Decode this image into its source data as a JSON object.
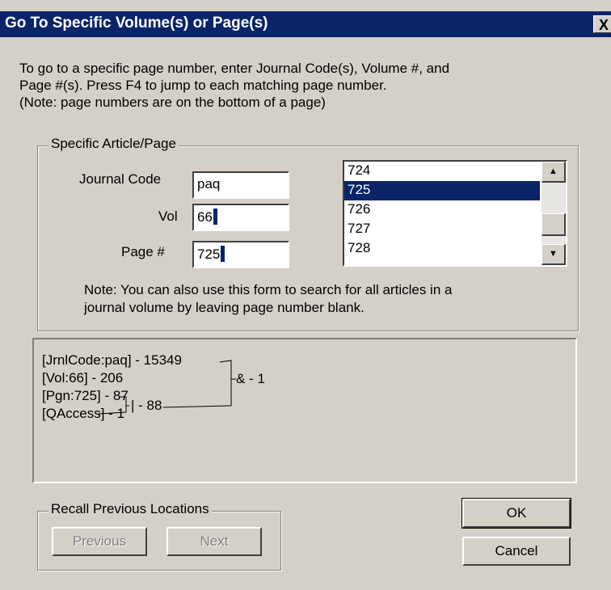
{
  "dialog": {
    "title": "Go To Specific Volume(s) or Page(s)",
    "close_glyph": "X"
  },
  "instructions": "To go to a specific page number, enter Journal Code(s), Volume #, and\nPage #(s).  Press F4 to jump to each matching page number.\n(Note: page numbers are on the bottom of a page)",
  "specific_group": {
    "label": "Specific Article/Page",
    "journal_code": {
      "label": "Journal Code",
      "value": "paq"
    },
    "vol": {
      "label": "Vol",
      "value": "66"
    },
    "page": {
      "label": "Page #",
      "value": "725"
    },
    "page_list": {
      "items": [
        "724",
        "725",
        "726",
        "727",
        "728"
      ],
      "selected": "725"
    },
    "note": "Note: You can also use this form to search for all articles in a\njournal volume by leaving page number blank."
  },
  "query_results": {
    "lines": [
      "[JrnlCode:paq] - 15349",
      "[Vol:66] - 206",
      "[Pgn:725] - 87",
      "[QAccess] - 1"
    ],
    "or_result": "| - 88",
    "and_result": "& - 1"
  },
  "recall_group": {
    "label": "Recall Previous Locations",
    "previous_label": "Previous",
    "next_label": "Next"
  },
  "actions": {
    "ok_label": "OK",
    "cancel_label": "Cancel"
  },
  "colors": {
    "title_bar": "#0a246a",
    "face": "#d4d0c8",
    "selection": "#0a246a"
  }
}
